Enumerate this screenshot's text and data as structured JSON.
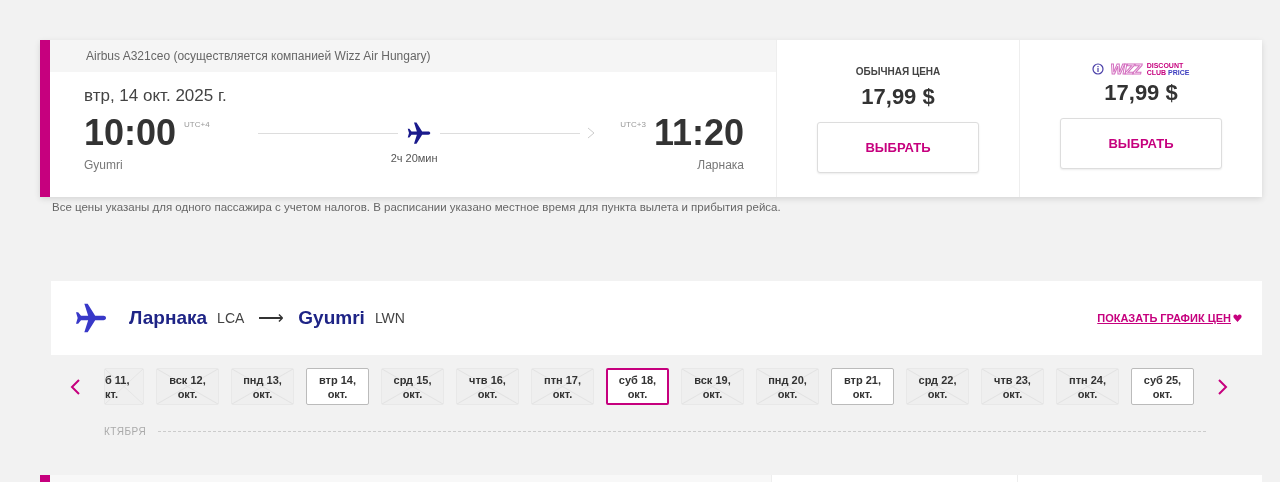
{
  "flight": {
    "aircraft": "Airbus A321ceo (осуществляется компанией Wizz Air Hungary)",
    "date": "втр, 14 окт. 2025 г.",
    "departure": {
      "time": "10:00",
      "utc": "UTC+4",
      "city": "Gyumri"
    },
    "arrival": {
      "time": "11:20",
      "utc": "UTC+3",
      "city": "Ларнака"
    },
    "duration": "2ч 20мин",
    "fares": [
      {
        "kind": "regular",
        "label": "ОБЫЧНАЯ ЦЕНА",
        "price": "17,99 $",
        "button": "ВЫБРАТЬ"
      },
      {
        "kind": "club",
        "logo_word": "WIZZ",
        "logo_top": "DISCOUNT",
        "logo_bottom_1": "CLUB",
        "logo_bottom_2": "PRICE",
        "price": "17,99 $",
        "button": "ВЫБРАТЬ"
      }
    ]
  },
  "note": "Все цены указаны для одного пассажира с учетом налогов. В расписании указано местное время для пункта вылета и прибытия рейса.",
  "route": {
    "from_city": "Ларнака",
    "from_code": "LCA",
    "arrow": "⟶",
    "to_city": "Gyumri",
    "to_code": "LWN",
    "chart_link": "ПОКАЗАТЬ ГРАФИК ЦЕН"
  },
  "dates": [
    {
      "day": "б 11,",
      "month": "кт.",
      "available": false,
      "selected": false
    },
    {
      "day": "вск 12,",
      "month": "окт.",
      "available": false,
      "selected": false
    },
    {
      "day": "пнд 13,",
      "month": "окт.",
      "available": false,
      "selected": false
    },
    {
      "day": "втр 14,",
      "month": "окт.",
      "available": true,
      "selected": false
    },
    {
      "day": "срд 15,",
      "month": "окт.",
      "available": false,
      "selected": false
    },
    {
      "day": "чтв 16,",
      "month": "окт.",
      "available": false,
      "selected": false
    },
    {
      "day": "птн 17,",
      "month": "окт.",
      "available": false,
      "selected": false
    },
    {
      "day": "суб 18,",
      "month": "окт.",
      "available": true,
      "selected": true
    },
    {
      "day": "вск 19,",
      "month": "окт.",
      "available": false,
      "selected": false
    },
    {
      "day": "пнд 20,",
      "month": "окт.",
      "available": false,
      "selected": false
    },
    {
      "day": "втр 21,",
      "month": "окт.",
      "available": true,
      "selected": false
    },
    {
      "day": "срд 22,",
      "month": "окт.",
      "available": false,
      "selected": false
    },
    {
      "day": "чтв 23,",
      "month": "окт.",
      "available": false,
      "selected": false
    },
    {
      "day": "птн 24,",
      "month": "окт.",
      "available": false,
      "selected": false
    },
    {
      "day": "суб 25,",
      "month": "окт.",
      "available": true,
      "selected": false
    }
  ],
  "month_label": "КТЯБРЯ"
}
